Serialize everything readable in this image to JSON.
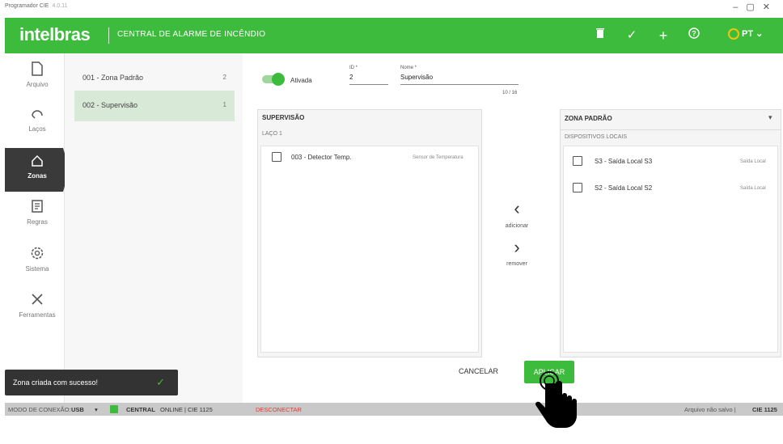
{
  "window": {
    "title": "Programador CIE",
    "version": "4.0.11"
  },
  "topbar": {
    "logo": "intelbras",
    "app_title": "CENTRAL DE ALARME DE INCÊNDIO",
    "lang": "PT",
    "icons": [
      "trash-icon",
      "check-icon",
      "plus-icon",
      "help-icon",
      "language-icon"
    ]
  },
  "sidebar": {
    "items": [
      {
        "label": "Arquivo",
        "icon": "file-icon"
      },
      {
        "label": "Laços",
        "icon": "loop-icon"
      },
      {
        "label": "Zonas",
        "icon": "home-icon"
      },
      {
        "label": "Regras",
        "icon": "rules-icon"
      },
      {
        "label": "Sistema",
        "icon": "gear-icon"
      },
      {
        "label": "Ferramentas",
        "icon": "tools-icon"
      }
    ],
    "active": "Zonas"
  },
  "zones": [
    {
      "name": "001 - Zona Padrão",
      "count": "2"
    },
    {
      "name": "002 - Supervisão",
      "count": "1"
    }
  ],
  "form": {
    "active_label": "Ativada",
    "id_label": "ID *",
    "id_value": "2",
    "name_label": "Nome *",
    "name_value": "Supervisão",
    "name_counter": "10 / 16"
  },
  "left_panel": {
    "title": "SUPERVISÃO",
    "subtitle": "LAÇO 1",
    "devices": [
      {
        "name": "003 - Detector Temp.",
        "type": "Sensor de Temperatura"
      }
    ]
  },
  "transfer": {
    "add_label": "adicionar",
    "remove_label": "remover"
  },
  "right_panel": {
    "title": "ZONA PADRÃO",
    "subtitle": "DISPOSITIVOS LOCAIS",
    "devices": [
      {
        "name": "S3 - Saída Local S3",
        "type": "Saída Local"
      },
      {
        "name": "S2 - Saída Local S2",
        "type": "Saída Local"
      }
    ]
  },
  "buttons": {
    "cancel": "CANCELAR",
    "apply": "APLICAR"
  },
  "toast": {
    "message": "Zona criada com sucesso!"
  },
  "statusbar": {
    "mode_label": "MODO DE CONEXÃO:",
    "mode_value": "USB",
    "central_label": "CENTRAL",
    "central_status": "ONLINE | CIE 1125",
    "disconnect": "DESCONECTAR",
    "file_status": "Arquivo não salvo |",
    "file_model": "CIE 1125"
  },
  "colors": {
    "brand_green": "#3dbb3d",
    "dark": "#3a3a3a",
    "selected_zone": "#d8e9d8",
    "disconnect_red": "#e53935"
  }
}
